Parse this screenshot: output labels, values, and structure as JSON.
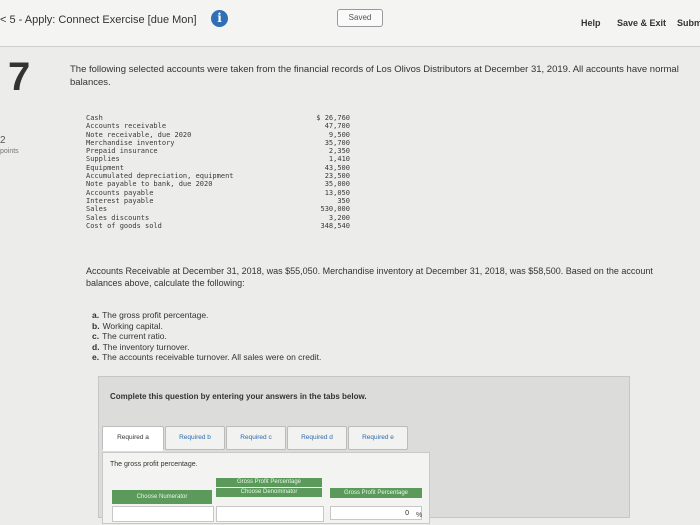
{
  "header": {
    "breadcrumb": "< 5 - Apply: Connect Exercise [due Mon]",
    "info_icon": "i",
    "saved": "Saved",
    "help": "Help",
    "save_exit": "Save & Exit",
    "submit": "Subm"
  },
  "question": {
    "number": "7",
    "points_value": "2",
    "points_label": "points",
    "intro": "The following selected accounts were taken from the financial records of Los Olivos Distributors at December 31, 2019. All accounts have normal balances."
  },
  "accounts": [
    {
      "name": "Cash",
      "amount": "$ 26,760"
    },
    {
      "name": "Accounts receivable",
      "amount": "47,700"
    },
    {
      "name": "Note receivable, due 2020",
      "amount": "9,500"
    },
    {
      "name": "Merchandise inventory",
      "amount": "35,700"
    },
    {
      "name": "Prepaid insurance",
      "amount": "2,350"
    },
    {
      "name": "Supplies",
      "amount": "1,410"
    },
    {
      "name": "Equipment",
      "amount": "43,500"
    },
    {
      "name": "Accumulated depreciation, equipment",
      "amount": "23,500"
    },
    {
      "name": "Note payable to bank, due 2020",
      "amount": "35,000"
    },
    {
      "name": "Accounts payable",
      "amount": "13,050"
    },
    {
      "name": "Interest payable",
      "amount": "350"
    },
    {
      "name": "Sales",
      "amount": "530,000"
    },
    {
      "name": "Sales discounts",
      "amount": "3,200"
    },
    {
      "name": "Cost of goods sold",
      "amount": "348,540"
    }
  ],
  "paragraph": "Accounts Receivable at December 31, 2018, was $55,050. Merchandise inventory at December 31, 2018, was $58,500. Based on the account balances above, calculate the following:",
  "requirements": [
    {
      "letter": "a.",
      "text": "The gross profit percentage."
    },
    {
      "letter": "b.",
      "text": "Working capital."
    },
    {
      "letter": "c.",
      "text": "The current ratio."
    },
    {
      "letter": "d.",
      "text": "The inventory turnover."
    },
    {
      "letter": "e.",
      "text": "The accounts receivable turnover. All sales were on credit."
    }
  ],
  "panel": {
    "instruction": "Complete this question by entering your answers in the tabs below.",
    "tabs": [
      {
        "label": "Required a"
      },
      {
        "label": "Required b"
      },
      {
        "label": "Required c"
      },
      {
        "label": "Required d"
      },
      {
        "label": "Required e"
      }
    ],
    "answer_label": "The gross profit percentage.",
    "header_top": "Gross Profit Percentage",
    "choose_numerator": "Choose Numerator",
    "choose_denominator": "Choose Denominator",
    "gross_profit_percentage": "Gross Profit Percentage",
    "value": "0",
    "pct": "%"
  }
}
